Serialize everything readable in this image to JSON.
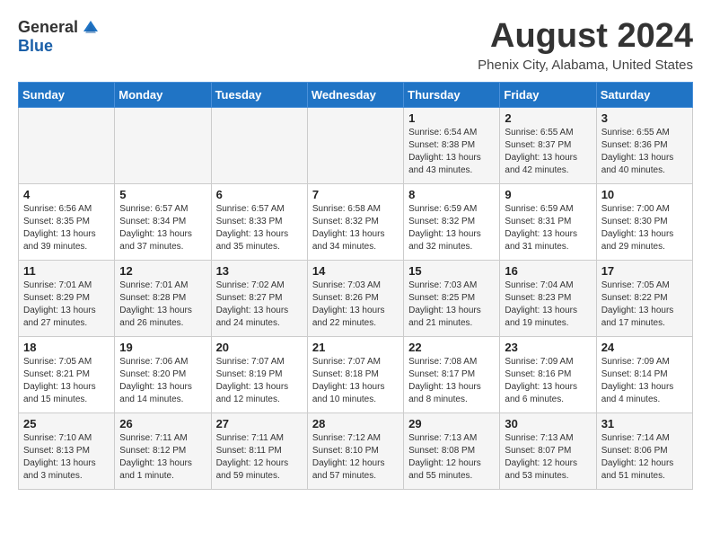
{
  "header": {
    "logo_general": "General",
    "logo_blue": "Blue",
    "month_title": "August 2024",
    "location": "Phenix City, Alabama, United States"
  },
  "calendar": {
    "days_of_week": [
      "Sunday",
      "Monday",
      "Tuesday",
      "Wednesday",
      "Thursday",
      "Friday",
      "Saturday"
    ],
    "weeks": [
      [
        {
          "day": "",
          "info": ""
        },
        {
          "day": "",
          "info": ""
        },
        {
          "day": "",
          "info": ""
        },
        {
          "day": "",
          "info": ""
        },
        {
          "day": "1",
          "info": "Sunrise: 6:54 AM\nSunset: 8:38 PM\nDaylight: 13 hours\nand 43 minutes."
        },
        {
          "day": "2",
          "info": "Sunrise: 6:55 AM\nSunset: 8:37 PM\nDaylight: 13 hours\nand 42 minutes."
        },
        {
          "day": "3",
          "info": "Sunrise: 6:55 AM\nSunset: 8:36 PM\nDaylight: 13 hours\nand 40 minutes."
        }
      ],
      [
        {
          "day": "4",
          "info": "Sunrise: 6:56 AM\nSunset: 8:35 PM\nDaylight: 13 hours\nand 39 minutes."
        },
        {
          "day": "5",
          "info": "Sunrise: 6:57 AM\nSunset: 8:34 PM\nDaylight: 13 hours\nand 37 minutes."
        },
        {
          "day": "6",
          "info": "Sunrise: 6:57 AM\nSunset: 8:33 PM\nDaylight: 13 hours\nand 35 minutes."
        },
        {
          "day": "7",
          "info": "Sunrise: 6:58 AM\nSunset: 8:32 PM\nDaylight: 13 hours\nand 34 minutes."
        },
        {
          "day": "8",
          "info": "Sunrise: 6:59 AM\nSunset: 8:32 PM\nDaylight: 13 hours\nand 32 minutes."
        },
        {
          "day": "9",
          "info": "Sunrise: 6:59 AM\nSunset: 8:31 PM\nDaylight: 13 hours\nand 31 minutes."
        },
        {
          "day": "10",
          "info": "Sunrise: 7:00 AM\nSunset: 8:30 PM\nDaylight: 13 hours\nand 29 minutes."
        }
      ],
      [
        {
          "day": "11",
          "info": "Sunrise: 7:01 AM\nSunset: 8:29 PM\nDaylight: 13 hours\nand 27 minutes."
        },
        {
          "day": "12",
          "info": "Sunrise: 7:01 AM\nSunset: 8:28 PM\nDaylight: 13 hours\nand 26 minutes."
        },
        {
          "day": "13",
          "info": "Sunrise: 7:02 AM\nSunset: 8:27 PM\nDaylight: 13 hours\nand 24 minutes."
        },
        {
          "day": "14",
          "info": "Sunrise: 7:03 AM\nSunset: 8:26 PM\nDaylight: 13 hours\nand 22 minutes."
        },
        {
          "day": "15",
          "info": "Sunrise: 7:03 AM\nSunset: 8:25 PM\nDaylight: 13 hours\nand 21 minutes."
        },
        {
          "day": "16",
          "info": "Sunrise: 7:04 AM\nSunset: 8:23 PM\nDaylight: 13 hours\nand 19 minutes."
        },
        {
          "day": "17",
          "info": "Sunrise: 7:05 AM\nSunset: 8:22 PM\nDaylight: 13 hours\nand 17 minutes."
        }
      ],
      [
        {
          "day": "18",
          "info": "Sunrise: 7:05 AM\nSunset: 8:21 PM\nDaylight: 13 hours\nand 15 minutes."
        },
        {
          "day": "19",
          "info": "Sunrise: 7:06 AM\nSunset: 8:20 PM\nDaylight: 13 hours\nand 14 minutes."
        },
        {
          "day": "20",
          "info": "Sunrise: 7:07 AM\nSunset: 8:19 PM\nDaylight: 13 hours\nand 12 minutes."
        },
        {
          "day": "21",
          "info": "Sunrise: 7:07 AM\nSunset: 8:18 PM\nDaylight: 13 hours\nand 10 minutes."
        },
        {
          "day": "22",
          "info": "Sunrise: 7:08 AM\nSunset: 8:17 PM\nDaylight: 13 hours\nand 8 minutes."
        },
        {
          "day": "23",
          "info": "Sunrise: 7:09 AM\nSunset: 8:16 PM\nDaylight: 13 hours\nand 6 minutes."
        },
        {
          "day": "24",
          "info": "Sunrise: 7:09 AM\nSunset: 8:14 PM\nDaylight: 13 hours\nand 4 minutes."
        }
      ],
      [
        {
          "day": "25",
          "info": "Sunrise: 7:10 AM\nSunset: 8:13 PM\nDaylight: 13 hours\nand 3 minutes."
        },
        {
          "day": "26",
          "info": "Sunrise: 7:11 AM\nSunset: 8:12 PM\nDaylight: 13 hours\nand 1 minute."
        },
        {
          "day": "27",
          "info": "Sunrise: 7:11 AM\nSunset: 8:11 PM\nDaylight: 12 hours\nand 59 minutes."
        },
        {
          "day": "28",
          "info": "Sunrise: 7:12 AM\nSunset: 8:10 PM\nDaylight: 12 hours\nand 57 minutes."
        },
        {
          "day": "29",
          "info": "Sunrise: 7:13 AM\nSunset: 8:08 PM\nDaylight: 12 hours\nand 55 minutes."
        },
        {
          "day": "30",
          "info": "Sunrise: 7:13 AM\nSunset: 8:07 PM\nDaylight: 12 hours\nand 53 minutes."
        },
        {
          "day": "31",
          "info": "Sunrise: 7:14 AM\nSunset: 8:06 PM\nDaylight: 12 hours\nand 51 minutes."
        }
      ]
    ]
  }
}
